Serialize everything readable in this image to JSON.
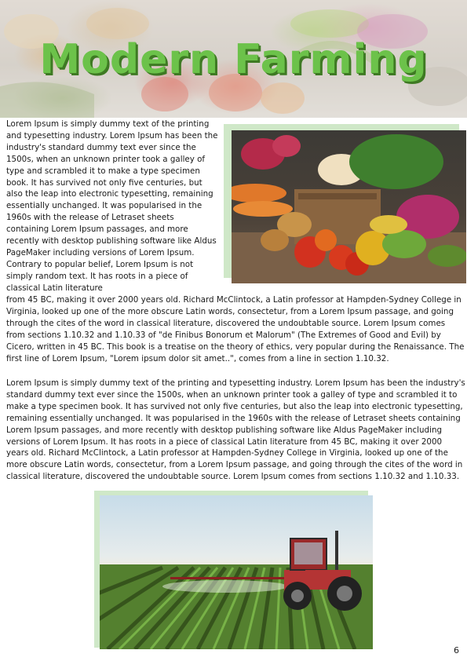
{
  "header": {
    "title": "Modern Farming"
  },
  "article": {
    "paragraph1_part1": "Lorem Ipsum is simply dummy text of the printing and typesetting industry. Lorem Ipsum has been the industry's standard dummy text ever since the 1500s, when an unknown printer took a galley of type and scrambled it to make a type specimen book. It has survived not only five centuries, but also the leap into electronic typesetting, remaining essentially unchanged. It was popularised in the 1960s with the release of Letraset sheets containing Lorem Ipsum passages, and more recently with desktop publishing software like Aldus PageMaker including versions of Lorem Ipsum. Contrary to popular belief, Lorem Ipsum is not simply random text. It has roots in a piece of classical Latin literature",
    "paragraph1_part2": "from 45 BC, making it over 2000 years old. Richard McClintock, a Latin professor at Hampden-Sydney College in Virginia, looked up one of the more obscure Latin words, consectetur, from a Lorem Ipsum passage, and going through the cites of the word in classical literature, discovered the undoubtable source. Lorem Ipsum comes from sections 1.10.32 and 1.10.33 of \"de Finibus Bonorum et Malorum\" (The Extremes of Good and Evil) by Cicero, written in 45 BC. This book is a treatise on the theory of ethics, very popular during the Renaissance. The first line of Lorem Ipsum, \"Lorem ipsum dolor sit amet..\", comes from a line in section 1.10.32.",
    "paragraph2": "Lorem Ipsum is simply dummy text of the printing and typesetting industry. Lorem Ipsum has been the industry's standard dummy text ever since the 1500s, when an unknown printer took a galley of type and scrambled it to make a type specimen book. It has survived not only five centuries, but also the leap into electronic typesetting, remaining essentially unchanged. It was popularised in the 1960s with the release of Letraset sheets containing Lorem Ipsum passages, and more recently with desktop publishing software like Aldus PageMaker including versions of Lorem Ipsum. It has roots in a piece of classical Latin literature from 45 BC, making it over 2000 years old. Richard McClintock, a Latin professor at Hampden-Sydney College in Virginia, looked up one of the more obscure Latin words, consectetur, from a Lorem Ipsum passage, and going through the cites of the word in classical literature, discovered the undoubtable source. Lorem Ipsum comes from sections 1.10.32 and 1.10.33."
  },
  "footer": {
    "page_number": "6"
  },
  "theme": {
    "title_color": "#6cc24a",
    "title_shadow": "#3e7a23",
    "frame_color": "#cfe8c8"
  }
}
